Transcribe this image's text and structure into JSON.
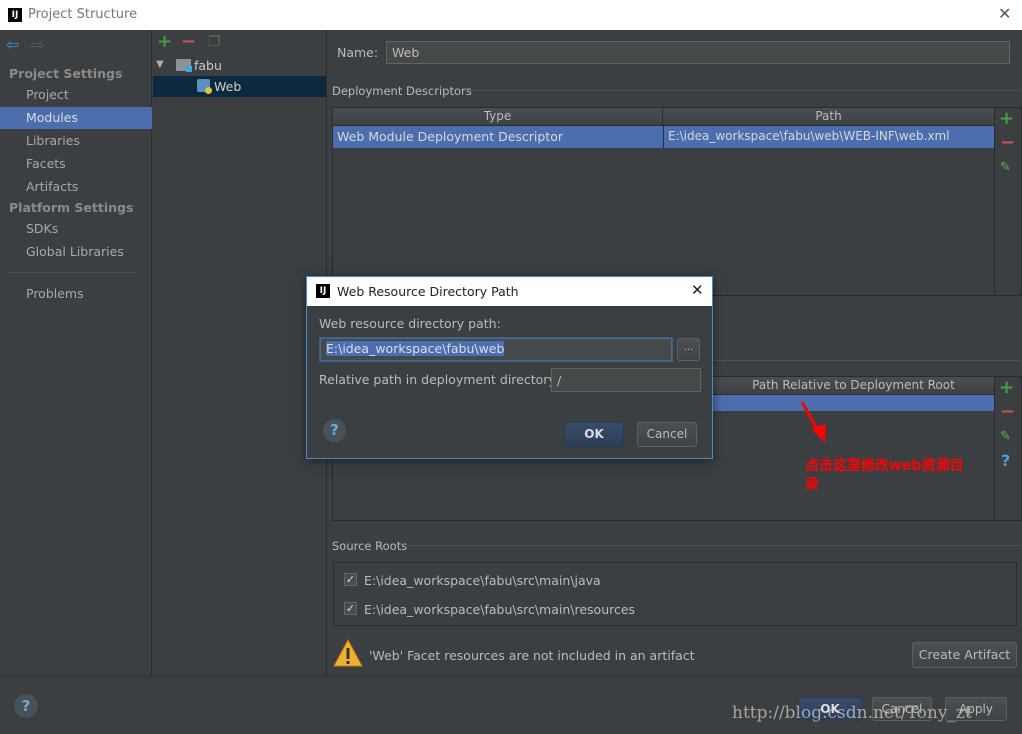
{
  "window": {
    "title": "Project Structure",
    "close": "✕"
  },
  "sidebar": {
    "project_settings": "Project Settings",
    "items1": [
      "Project",
      "Modules",
      "Libraries",
      "Facets",
      "Artifacts"
    ],
    "platform_settings": "Platform Settings",
    "items2": [
      "SDKs",
      "Global Libraries"
    ],
    "problems": "Problems",
    "selected": "Modules"
  },
  "tree": {
    "root": "fabu",
    "child": "Web"
  },
  "main": {
    "name_label": "Name:",
    "name_value": "Web",
    "deployment_descriptors": "Deployment Descriptors",
    "dd_table": {
      "columns": [
        "Type",
        "Path"
      ],
      "rows": [
        [
          "Web Module Deployment Descriptor",
          "E:\\idea_workspace\\fabu\\web\\WEB-INF\\web.xml"
        ]
      ]
    },
    "wrd_table": {
      "columns": [
        "",
        "Path Relative to Deployment Root"
      ]
    },
    "source_roots": "Source Roots",
    "source_root_items": [
      "E:\\idea_workspace\\fabu\\src\\main\\java",
      "E:\\idea_workspace\\fabu\\src\\main\\resources"
    ],
    "warning": "'Web' Facet resources are not included in an artifact",
    "create_artifact": "Create Artifact"
  },
  "footer": {
    "ok": "OK",
    "cancel": "Cancel",
    "apply": "Apply",
    "watermark": "http://blog.csdn.net/Tony_zt"
  },
  "dialog": {
    "title": "Web Resource Directory Path",
    "path_label": "Web resource directory path:",
    "path_value": "E:\\idea_workspace\\fabu\\web",
    "browse": "...",
    "relative_label": "Relative path in deployment directory:",
    "relative_value": "/",
    "ok": "OK",
    "cancel": "Cancel"
  },
  "annotation": {
    "text": "点击这里修改web资源目录",
    "color": "#ff0000"
  }
}
